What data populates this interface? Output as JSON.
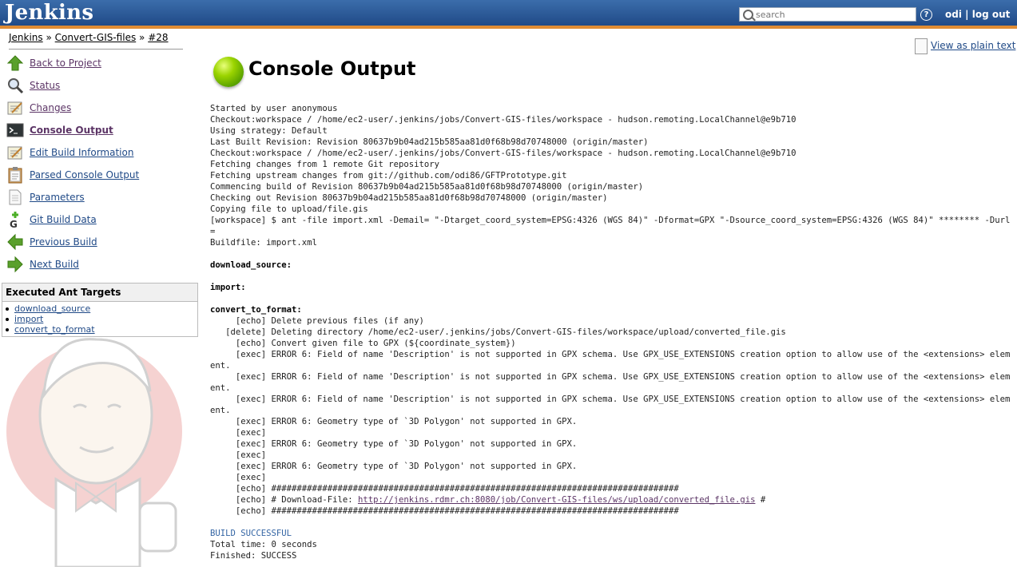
{
  "header": {
    "logo": "Jenkins",
    "search_placeholder": "search",
    "user": "odi",
    "separator": "|",
    "logout": "log out"
  },
  "breadcrumb": {
    "items": [
      "Jenkins",
      "Convert-GIS-files",
      "#28"
    ],
    "separator": "»"
  },
  "sidebar": {
    "tasks": [
      {
        "label": "Back to Project",
        "icon": "up-arrow-icon"
      },
      {
        "label": "Status",
        "icon": "magnifier-icon"
      },
      {
        "label": "Changes",
        "icon": "notepad-icon"
      },
      {
        "label": "Console Output",
        "icon": "terminal-icon"
      },
      {
        "label": "Edit Build Information",
        "icon": "notepad-icon"
      },
      {
        "label": "Parsed Console Output",
        "icon": "clipboard-icon"
      },
      {
        "label": "Parameters",
        "icon": "document-icon"
      },
      {
        "label": "Git Build Data",
        "icon": "git-icon"
      },
      {
        "label": "Previous Build",
        "icon": "left-arrow-icon"
      },
      {
        "label": "Next Build",
        "icon": "right-arrow-icon"
      }
    ],
    "ant_panel": {
      "title": "Executed Ant Targets",
      "targets": [
        "download_source",
        "import",
        "convert_to_format"
      ]
    }
  },
  "main": {
    "view_plain_text": "View as plain text",
    "title": "Console Output",
    "console": [
      {
        "t": "Started by user anonymous"
      },
      {
        "t": "Checkout:workspace / /home/ec2-user/.jenkins/jobs/Convert-GIS-files/workspace - hudson.remoting.LocalChannel@e9b710"
      },
      {
        "t": "Using strategy: Default"
      },
      {
        "t": "Last Built Revision: Revision 80637b9b04ad215b585aa81d0f68b98d70748000 (origin/master)"
      },
      {
        "t": "Checkout:workspace / /home/ec2-user/.jenkins/jobs/Convert-GIS-files/workspace - hudson.remoting.LocalChannel@e9b710"
      },
      {
        "t": "Fetching changes from 1 remote Git repository"
      },
      {
        "t": "Fetching upstream changes from git://github.com/odi86/GFTPrototype.git"
      },
      {
        "t": "Commencing build of Revision 80637b9b04ad215b585aa81d0f68b98d70748000 (origin/master)"
      },
      {
        "t": "Checking out Revision 80637b9b04ad215b585aa81d0f68b98d70748000 (origin/master)"
      },
      {
        "t": "Copying file to upload/file.gis"
      },
      {
        "t": "[workspace] $ ant -file import.xml -Demail= \"-Dtarget_coord_system=EPSG:4326 (WGS 84)\" -Dformat=GPX \"-Dsource_coord_system=EPSG:4326 (WGS 84)\" ******** -Durl="
      },
      {
        "t": "Buildfile: import.xml"
      },
      {
        "t": ""
      },
      {
        "t": "download_source:",
        "s": "b"
      },
      {
        "t": ""
      },
      {
        "t": "import:",
        "s": "b"
      },
      {
        "t": ""
      },
      {
        "t": "convert_to_format:",
        "s": "b"
      },
      {
        "t": "     [echo] Delete previous files (if any)"
      },
      {
        "t": "   [delete] Deleting directory /home/ec2-user/.jenkins/jobs/Convert-GIS-files/workspace/upload/converted_file.gis"
      },
      {
        "t": "     [echo] Convert given file to GPX (${coordinate_system})"
      },
      {
        "t": "     [exec] ERROR 6: Field of name 'Description' is not supported in GPX schema. Use GPX_USE_EXTENSIONS creation option to allow use of the <extensions> element."
      },
      {
        "t": "     [exec] ERROR 6: Field of name 'Description' is not supported in GPX schema. Use GPX_USE_EXTENSIONS creation option to allow use of the <extensions> element."
      },
      {
        "t": "     [exec] ERROR 6: Field of name 'Description' is not supported in GPX schema. Use GPX_USE_EXTENSIONS creation option to allow use of the <extensions> element."
      },
      {
        "t": "     [exec] ERROR 6: Geometry type of `3D Polygon' not supported in GPX."
      },
      {
        "t": "     [exec]"
      },
      {
        "t": "     [exec] ERROR 6: Geometry type of `3D Polygon' not supported in GPX."
      },
      {
        "t": "     [exec]"
      },
      {
        "t": "     [exec] ERROR 6: Geometry type of `3D Polygon' not supported in GPX."
      },
      {
        "t": "     [exec]"
      },
      {
        "t": "     [echo] ################################################################################"
      },
      {
        "t": "     [echo] # Download-File: ",
        "link": "http://jenkins.rdmr.ch:8080/job/Convert-GIS-files/ws/upload/converted_file.gis",
        "after": " #"
      },
      {
        "t": "     [echo] ################################################################################"
      },
      {
        "t": ""
      },
      {
        "t": "BUILD SUCCESSFUL",
        "s": "ok"
      },
      {
        "t": "Total time: 0 seconds"
      },
      {
        "t": "Finished: SUCCESS"
      }
    ]
  }
}
